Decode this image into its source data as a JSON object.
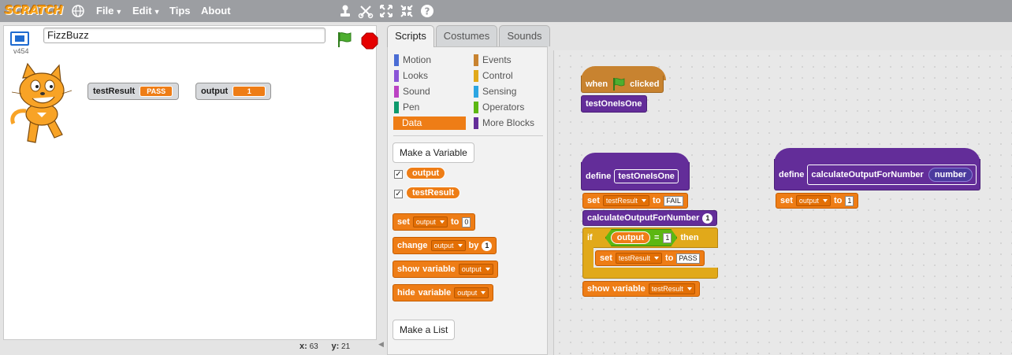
{
  "topbar": {
    "logo": "SCRATCH",
    "menus": [
      "File",
      "Edit",
      "Tips",
      "About"
    ],
    "tool_icons": [
      "duplicate-stamp-icon",
      "cut-scissors-icon",
      "grow-icon",
      "shrink-icon",
      "help-icon"
    ]
  },
  "stage": {
    "project_title": "FizzBuzz",
    "version": "v454",
    "monitors": [
      {
        "name": "testResult",
        "value": "PASS"
      },
      {
        "name": "output",
        "value": "1"
      }
    ],
    "coords": {
      "x_label": "x:",
      "x": "63",
      "y_label": "y:",
      "y": "21"
    }
  },
  "tabs": [
    "Scripts",
    "Costumes",
    "Sounds"
  ],
  "palette": {
    "categories_left": [
      {
        "label": "Motion",
        "color": "#4a6cd4"
      },
      {
        "label": "Looks",
        "color": "#8a55d7"
      },
      {
        "label": "Sound",
        "color": "#bb42c3"
      },
      {
        "label": "Pen",
        "color": "#0e9a6c"
      },
      {
        "label": "Data",
        "color": "#ee7d16"
      }
    ],
    "categories_right": [
      {
        "label": "Events",
        "color": "#c88330"
      },
      {
        "label": "Control",
        "color": "#e1a91a"
      },
      {
        "label": "Sensing",
        "color": "#2ca5e2"
      },
      {
        "label": "Operators",
        "color": "#5cb712"
      },
      {
        "label": "More Blocks",
        "color": "#632d99"
      }
    ],
    "make_variable": "Make a Variable",
    "variables": [
      "output",
      "testResult"
    ],
    "blocks": {
      "set": {
        "kw": "set",
        "var": "output",
        "kw2": "to",
        "val": "0"
      },
      "change": {
        "kw": "change",
        "var": "output",
        "kw2": "by",
        "val": "1"
      },
      "show": {
        "kw": "show",
        "kw2": "variable",
        "var": "output"
      },
      "hide": {
        "kw": "hide",
        "kw2": "variable",
        "var": "output"
      }
    },
    "make_list": "Make a List"
  },
  "scripts": {
    "when_flag": {
      "when": "when",
      "clicked": "clicked"
    },
    "call1": "testOneIsOne",
    "define1": {
      "kw": "define",
      "name": "testOneIsOne"
    },
    "set1": {
      "kw": "set",
      "var": "testResult",
      "kw2": "to",
      "val": "FAIL"
    },
    "call2": {
      "name": "calculateOutputForNumber",
      "arg": "1"
    },
    "if_block": {
      "kw": "if",
      "reporter": "output",
      "op": "=",
      "val": "1",
      "then": "then"
    },
    "set2": {
      "kw": "set",
      "var": "testResult",
      "kw2": "to",
      "val": "PASS"
    },
    "show": {
      "kw": "show",
      "kw2": "variable",
      "var": "testResult"
    },
    "define2": {
      "kw": "define",
      "name": "calculateOutputForNumber",
      "param": "number"
    },
    "set3": {
      "kw": "set",
      "var": "output",
      "kw2": "to",
      "val": "1"
    }
  }
}
